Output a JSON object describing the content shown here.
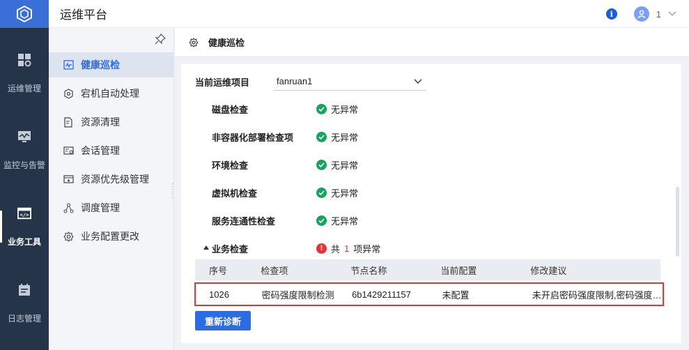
{
  "app": {
    "title": "运维平台"
  },
  "header": {
    "user_name": "1",
    "info_glyph": "i"
  },
  "rail": {
    "items": [
      {
        "label": "运维管理",
        "icon": "grid-gear-icon",
        "active": false
      },
      {
        "label": "监控与告警",
        "icon": "monitor-icon",
        "active": false
      },
      {
        "label": "业务工具",
        "icon": "code-window-icon",
        "active": true
      },
      {
        "label": "日志管理",
        "icon": "calendar-icon",
        "active": false
      }
    ]
  },
  "subnav": {
    "items": [
      {
        "label": "健康巡检",
        "icon": "pulse-icon",
        "active": true
      },
      {
        "label": "宕机自动处理",
        "icon": "shield-gear-icon",
        "active": false
      },
      {
        "label": "资源清理",
        "icon": "doc-clean-icon",
        "active": false
      },
      {
        "label": "会话管理",
        "icon": "session-icon",
        "active": false
      },
      {
        "label": "资源优先级管理",
        "icon": "priority-icon",
        "active": false
      },
      {
        "label": "调度管理",
        "icon": "schedule-icon",
        "active": false
      },
      {
        "label": "业务配置更改",
        "icon": "config-gear-icon",
        "active": false
      }
    ]
  },
  "page": {
    "title": "健康巡检"
  },
  "project": {
    "label": "当前运维项目",
    "value": "fanruan1"
  },
  "checks": [
    {
      "name": "磁盘检查",
      "status": "无异常"
    },
    {
      "name": "非容器化部署检查项",
      "status": "无异常"
    },
    {
      "name": "环境检查",
      "status": "无异常"
    },
    {
      "name": "虚拟机检查",
      "status": "无异常"
    },
    {
      "name": "服务连通性检查",
      "status": "无异常"
    }
  ],
  "business_check": {
    "name": "业务检查",
    "status_prefix": "共",
    "count": "1",
    "status_suffix": "项异常",
    "error_glyph": "!"
  },
  "table": {
    "columns": [
      "序号",
      "检查项",
      "节点名称",
      "当前配置",
      "修改建议"
    ],
    "rows": [
      [
        "1026",
        "密码强度限制检测",
        "6b1429211157",
        "未配置",
        "未开启密码强度限制,密码强度较…"
      ]
    ]
  },
  "actions": {
    "rediagnose_label": "重新诊断"
  },
  "colors": {
    "primary": "#2d6be0",
    "ok": "#19a35f",
    "error": "#e0353b",
    "rail_bg": "#26344a"
  }
}
